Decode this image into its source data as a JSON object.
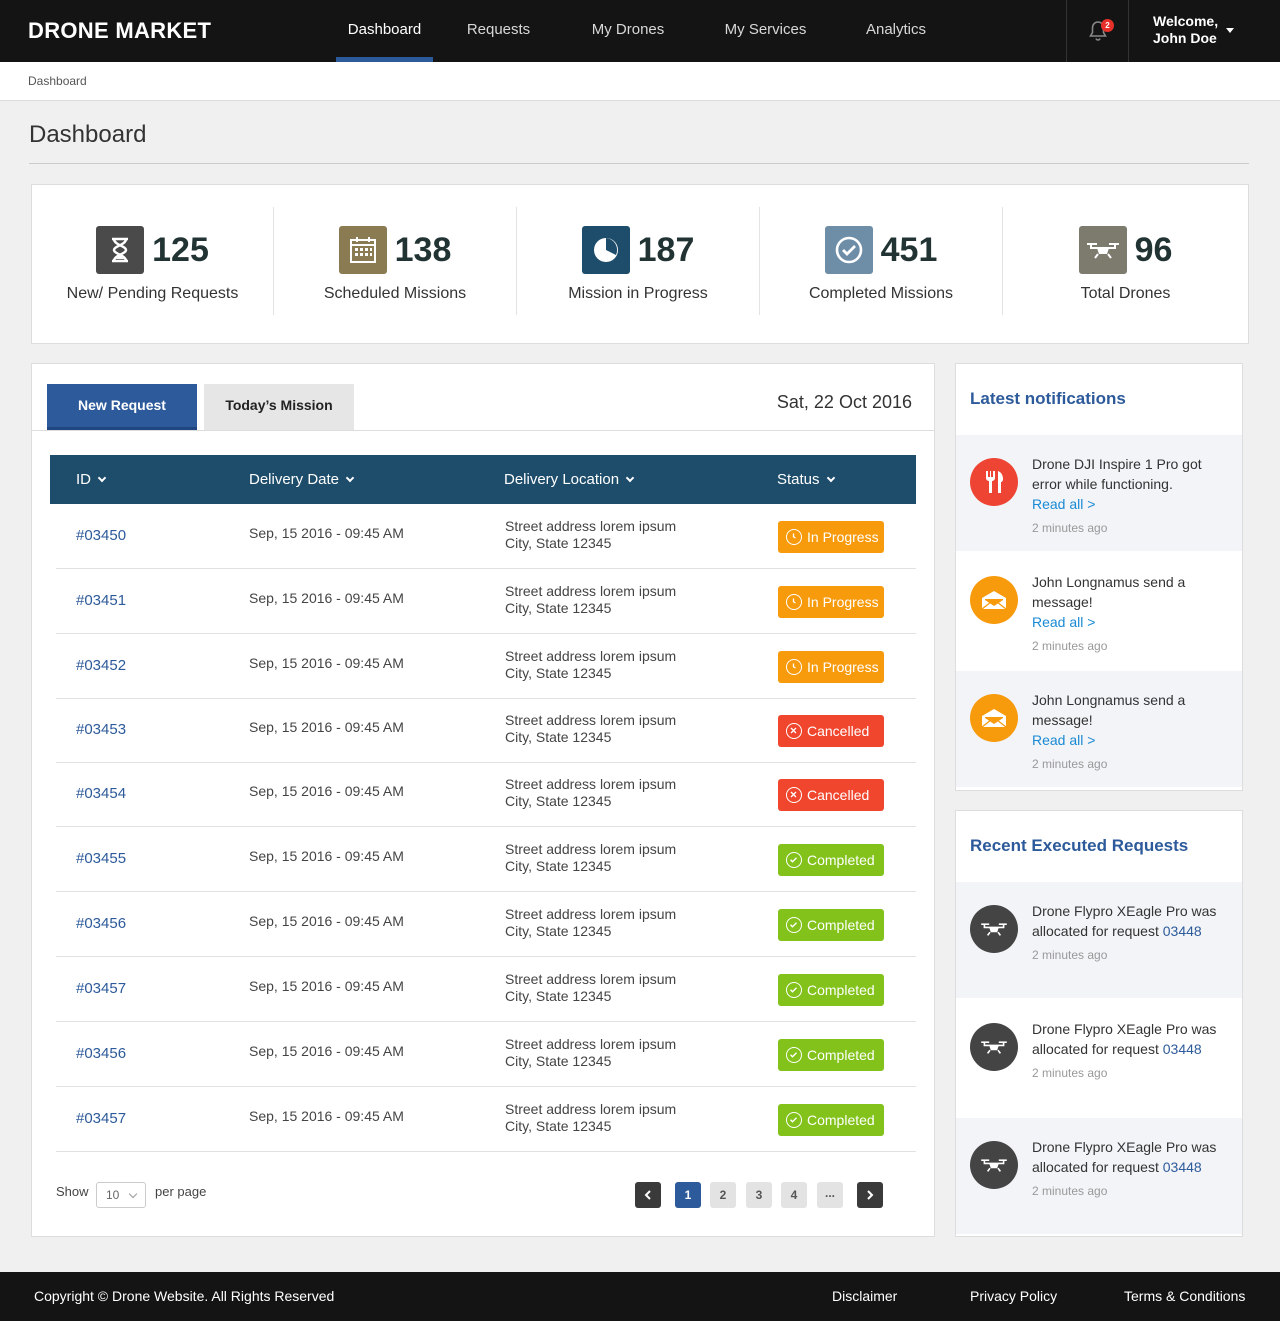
{
  "header": {
    "logo": "DRONE MARKET",
    "nav": [
      "Dashboard",
      "Requests",
      "My Drones",
      "My Services",
      "Analytics"
    ],
    "notif_count": "2",
    "welcome": "Welcome,",
    "user": "John Doe"
  },
  "breadcrumb": "Dashboard",
  "page_title": "Dashboard",
  "stats": [
    {
      "value": "125",
      "label": "New/ Pending Requests",
      "icon": "hourglass-icon",
      "color": "#4a4a4a"
    },
    {
      "value": "138",
      "label": "Scheduled Missions",
      "icon": "calendar-icon",
      "color": "#8a7b52"
    },
    {
      "value": "187",
      "label": "Mission in Progress",
      "icon": "pie-clock-icon",
      "color": "#1e4d6b"
    },
    {
      "value": "451",
      "label": "Completed Missions",
      "icon": "check-circle-icon",
      "color": "#6e8ea8"
    },
    {
      "value": "96",
      "label": "Total Drones",
      "icon": "drone-icon",
      "color": "#7d7b6e"
    }
  ],
  "tabs": {
    "new_request": "New Request",
    "todays_mission": "Today’s Mission"
  },
  "date": "Sat, 22 Oct 2016",
  "table": {
    "headers": [
      "ID",
      "Delivery Date",
      "Delivery Location",
      "Status"
    ],
    "rows": [
      {
        "id": "#03450",
        "date": "Sep, 15 2016 - 09:45 AM",
        "loc1": "Street address lorem ipsum",
        "loc2": "City, State 12345",
        "status": "In Progress"
      },
      {
        "id": "#03451",
        "date": "Sep, 15 2016 - 09:45 AM",
        "loc1": "Street address lorem ipsum",
        "loc2": "City, State 12345",
        "status": "In Progress"
      },
      {
        "id": "#03452",
        "date": "Sep, 15 2016 - 09:45 AM",
        "loc1": "Street address lorem ipsum",
        "loc2": "City, State 12345",
        "status": "In Progress"
      },
      {
        "id": "#03453",
        "date": "Sep, 15 2016 - 09:45 AM",
        "loc1": "Street address lorem ipsum",
        "loc2": "City, State 12345",
        "status": "Cancelled"
      },
      {
        "id": "#03454",
        "date": "Sep, 15 2016 - 09:45 AM",
        "loc1": "Street address lorem ipsum",
        "loc2": "City, State 12345",
        "status": "Cancelled"
      },
      {
        "id": "#03455",
        "date": "Sep, 15 2016 - 09:45 AM",
        "loc1": "Street address lorem ipsum",
        "loc2": "City, State 12345",
        "status": "Completed"
      },
      {
        "id": "#03456",
        "date": "Sep, 15 2016 - 09:45 AM",
        "loc1": "Street address lorem ipsum",
        "loc2": "City, State 12345",
        "status": "Completed"
      },
      {
        "id": "#03457",
        "date": "Sep, 15 2016 - 09:45 AM",
        "loc1": "Street address lorem ipsum",
        "loc2": "City, State 12345",
        "status": "Completed"
      },
      {
        "id": "#03456",
        "date": "Sep, 15 2016 - 09:45 AM",
        "loc1": "Street address lorem ipsum",
        "loc2": "City, State 12345",
        "status": "Completed"
      },
      {
        "id": "#03457",
        "date": "Sep, 15 2016 - 09:45 AM",
        "loc1": "Street address lorem ipsum",
        "loc2": "City, State 12345",
        "status": "Completed"
      }
    ]
  },
  "pagination": {
    "show": "Show",
    "per_page_value": "10",
    "per_page": "per page",
    "pages": [
      "1",
      "2",
      "3",
      "4",
      "..."
    ],
    "current": "1"
  },
  "notifications": {
    "title": "Latest notifications",
    "items": [
      {
        "text": "Drone DJI Inspire 1 Pro got error while functioning.",
        "link": "Read all >",
        "time": "2 minutes ago",
        "icon": "wrench-icon"
      },
      {
        "text": "John Longnamus send a message!",
        "link": "Read all >",
        "time": "2 minutes ago",
        "icon": "envelope-icon"
      },
      {
        "text": "John Longnamus send a message!",
        "link": "Read all >",
        "time": "2 minutes ago",
        "icon": "envelope-icon"
      }
    ]
  },
  "executed": {
    "title": "Recent Executed Requests",
    "items": [
      {
        "text": "Drone Flypro XEagle Pro was allocated for request",
        "ref": "03448",
        "time": "2 minutes ago"
      },
      {
        "text": "Drone Flypro XEagle Pro was allocated for request",
        "ref": "03448",
        "time": "2 minutes ago"
      },
      {
        "text": "Drone Flypro XEagle Pro was allocated for request",
        "ref": "03448",
        "time": "2 minutes ago"
      }
    ]
  },
  "footer": {
    "copyright": "Copyright © Drone Website. All Rights Reserved",
    "links": [
      "Disclaimer",
      "Privacy Policy",
      "Terms & Conditions"
    ]
  }
}
